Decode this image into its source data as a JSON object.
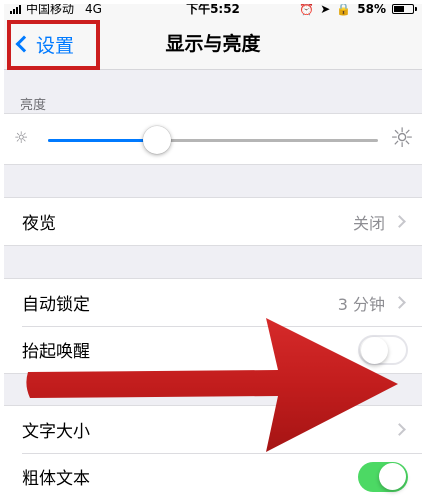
{
  "status_bar": {
    "carrier": "中国移动",
    "network": "4G",
    "time": "下午5:52",
    "battery": "58%",
    "battery_level": 0.58
  },
  "nav": {
    "back_label": "设置",
    "title": "显示与亮度"
  },
  "brightness": {
    "header": "亮度",
    "level": 0.33,
    "small_icon": "sun-small-icon",
    "large_icon": "sun-large-icon"
  },
  "night_shift": {
    "label": "夜览",
    "value": "关闭"
  },
  "auto_lock": {
    "label": "自动锁定",
    "value": "3 分钟"
  },
  "raise_to_wake": {
    "label": "抬起唤醒",
    "enabled": false
  },
  "text_size": {
    "label": "文字大小"
  },
  "bold_text": {
    "label": "粗体文本",
    "enabled": true
  },
  "colors": {
    "accent": "#007aff",
    "toggle_on": "#4cd964",
    "annotation": "#cc1e1e"
  }
}
